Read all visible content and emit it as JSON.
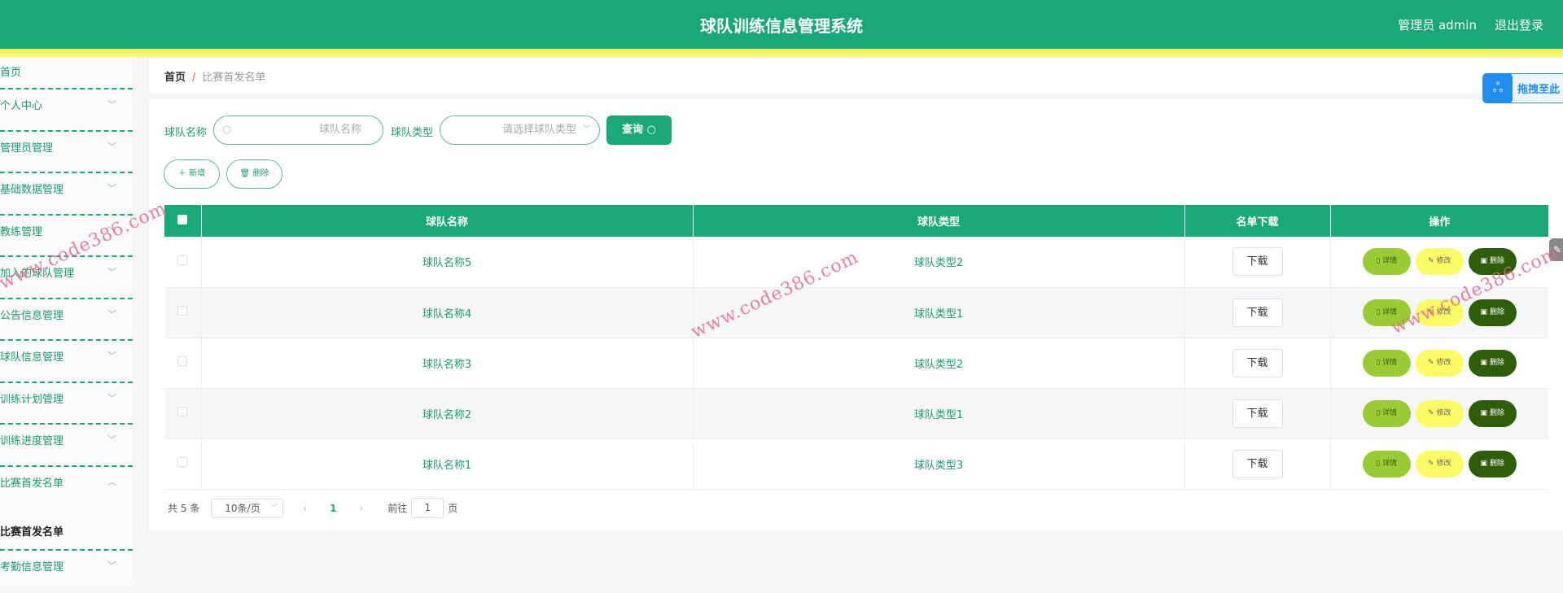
{
  "header": {
    "title": "球队训练信息管理系统",
    "user": "管理员 admin",
    "logout": "退出登录"
  },
  "sidebar": {
    "items": [
      {
        "label": "首页"
      },
      {
        "label": "个人中心"
      },
      {
        "label": "管理员管理"
      },
      {
        "label": "基础数据管理"
      },
      {
        "label": "教练管理"
      },
      {
        "label": "加入的球队管理"
      },
      {
        "label": "公告信息管理"
      },
      {
        "label": "球队信息管理"
      },
      {
        "label": "训练计划管理"
      },
      {
        "label": "训练进度管理"
      },
      {
        "label": "比赛首发名单"
      }
    ],
    "sub_item": "比赛首发名单",
    "last_item": "考勤信息管理"
  },
  "breadcrumb": {
    "home": "首页",
    "sep": "/",
    "current": "比赛首发名单"
  },
  "search": {
    "name_label": "球队名称",
    "name_placeholder": "球队名称",
    "type_label": "球队类型",
    "type_placeholder": "请选择球队类型",
    "query": "查询"
  },
  "actions": {
    "add": "新增",
    "delete": "删除"
  },
  "table": {
    "headers": [
      "球队名称",
      "球队类型",
      "名单下载",
      "操作"
    ],
    "rows": [
      {
        "name": "球队名称5",
        "type": "球队类型2"
      },
      {
        "name": "球队名称4",
        "type": "球队类型1"
      },
      {
        "name": "球队名称3",
        "type": "球队类型2"
      },
      {
        "name": "球队名称2",
        "type": "球队类型1"
      },
      {
        "name": "球队名称1",
        "type": "球队类型3"
      }
    ],
    "download": "下载",
    "detail": "详情",
    "edit": "修改",
    "remove": "删除"
  },
  "pagination": {
    "total": "共 5 条",
    "page_size": "10条/页",
    "current": "1",
    "goto": "前往",
    "goto_value": "1",
    "page_suffix": "页"
  },
  "widget": {
    "label": "拖拽至此"
  },
  "watermark": "www.code386.com",
  "colors": {
    "primary": "#1aa876",
    "stripe": "#fbfb6a",
    "detail": "#9acb34",
    "edit": "#fbfb66",
    "delete": "#2e5e0a"
  }
}
